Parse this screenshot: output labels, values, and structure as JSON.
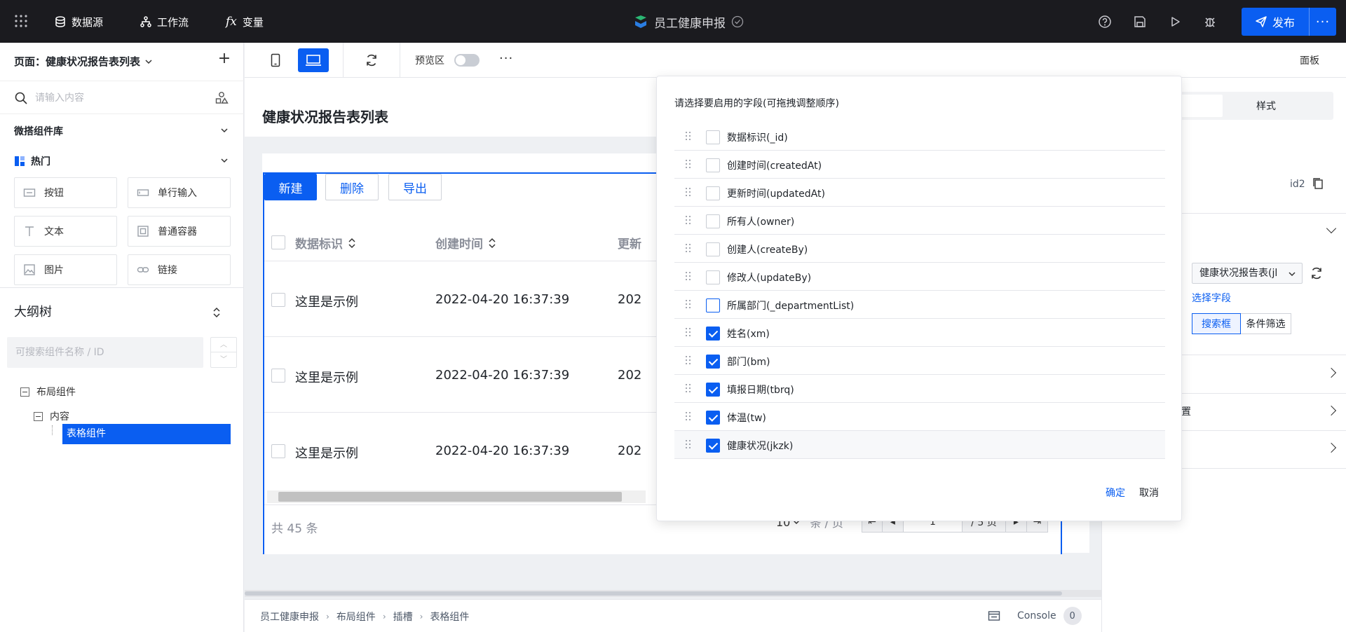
{
  "topbar": {
    "nav": [
      {
        "label": "数据源",
        "icon": "database-icon"
      },
      {
        "label": "工作流",
        "icon": "workflow-icon"
      },
      {
        "label": "变量",
        "icon": "fx-icon"
      }
    ],
    "app_title": "员工健康申报",
    "publish_label": "发布",
    "more_label": "···"
  },
  "left": {
    "page_selector": "页面：健康状况报告表列表",
    "search_placeholder": "请输入内容",
    "library_title": "微搭组件库",
    "category_title": "热门",
    "components": [
      {
        "label": "按钮",
        "icon": "button-icon"
      },
      {
        "label": "单行输入",
        "icon": "input-icon"
      },
      {
        "label": "文本",
        "icon": "text-icon"
      },
      {
        "label": "普通容器",
        "icon": "container-icon"
      },
      {
        "label": "图片",
        "icon": "image-icon"
      },
      {
        "label": "链接",
        "icon": "link-icon"
      }
    ],
    "outline_title": "大纲树",
    "outline_search_placeholder": "可搜索组件名称 / ID",
    "tree": [
      "布局组件",
      "内容",
      "表格组件"
    ]
  },
  "toolbar": {
    "preview_label": "预览区",
    "preview_on": false,
    "panel_label": "面板"
  },
  "canvas": {
    "page_title": "健康状况报告表列表",
    "actions": [
      "新建",
      "删除",
      "导出"
    ],
    "columns": [
      "数据标识",
      "创建时间",
      "更新"
    ],
    "rows": [
      {
        "id": "这里是示例",
        "created": "2022-04-20 16:37:39",
        "updated": "202"
      },
      {
        "id": "这里是示例",
        "created": "2022-04-20 16:37:39",
        "updated": "202"
      },
      {
        "id": "这里是示例",
        "created": "2022-04-20 16:37:39",
        "updated": "202"
      }
    ],
    "total": "共 45 条",
    "page_size": "10",
    "per_page_label": "条 / 页",
    "current_page": "1",
    "total_pages": "/ 5 页"
  },
  "breadcrumbs": [
    "员工健康申报",
    "布局组件",
    "插槽",
    "表格组件"
  ],
  "console": {
    "label": "Console",
    "count": "0"
  },
  "right": {
    "style_tab": "样式",
    "component_id": "id2",
    "datasource_select": "健康状况报告表(jl",
    "select_fields_link": "选择字段",
    "filter_modes": [
      "搜索框",
      "条件筛选"
    ],
    "partial_label": "置"
  },
  "popover": {
    "title": "请选择要启用的字段(可拖拽调整顺序)",
    "fields": [
      {
        "label": "数据标识(_id)",
        "checked": false
      },
      {
        "label": "创建时间(createdAt)",
        "checked": false
      },
      {
        "label": "更新时间(updatedAt)",
        "checked": false
      },
      {
        "label": "所有人(owner)",
        "checked": false
      },
      {
        "label": "创建人(createBy)",
        "checked": false
      },
      {
        "label": "修改人(updateBy)",
        "checked": false
      },
      {
        "label": "所属部门(_departmentList)",
        "checked": false
      },
      {
        "label": "姓名(xm)",
        "checked": true
      },
      {
        "label": "部门(bm)",
        "checked": true
      },
      {
        "label": "填报日期(tbrq)",
        "checked": true
      },
      {
        "label": "体温(tw)",
        "checked": true
      },
      {
        "label": "健康状况(jkzk)",
        "checked": true
      }
    ],
    "ok_label": "确定",
    "cancel_label": "取消"
  },
  "colors": {
    "accent": "#0a5ef1",
    "topbar_bg": "#1b1b1f"
  }
}
